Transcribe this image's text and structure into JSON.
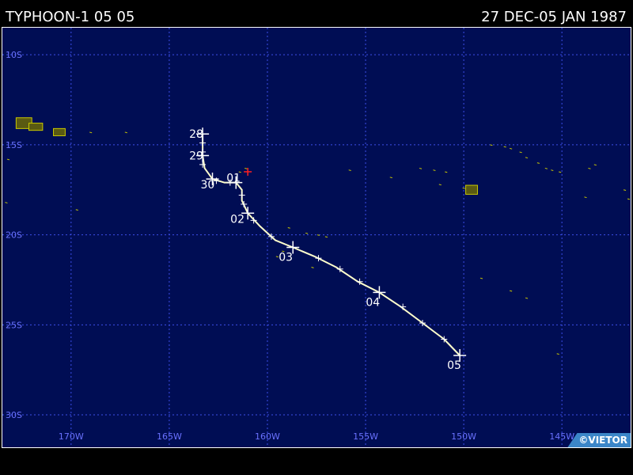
{
  "header": {
    "title": "TYPHOON-1 05 05",
    "date_range": "27 DEC-05 JAN 1987"
  },
  "credit": "©VIETOR",
  "colors": {
    "page_background": "#000000",
    "ocean": "#000d54",
    "grid": "#3c4ee8",
    "axis_label": "#6a72ff",
    "track": "#ffffcc",
    "land_fill": "#5a5a12",
    "land_outline": "#c8c800",
    "current_position": "#ff2020",
    "text": "#ffffff"
  },
  "map": {
    "projection": "equirectangular",
    "lon_range_west": [
      173.5,
      141.5
    ],
    "lat_range_south": [
      8.5,
      31.8
    ],
    "grid": true,
    "latitude_lines": [
      {
        "value": 10,
        "label": "10S"
      },
      {
        "value": 15,
        "label": "15S"
      },
      {
        "value": 20,
        "label": "20S"
      },
      {
        "value": 25,
        "label": "25S"
      },
      {
        "value": 30,
        "label": "30S"
      }
    ],
    "longitude_lines": [
      {
        "value": 170,
        "label": "170W"
      },
      {
        "value": 165,
        "label": "165W"
      },
      {
        "value": 160,
        "label": "160W"
      },
      {
        "value": 155,
        "label": "155W"
      },
      {
        "value": 150,
        "label": "150W"
      },
      {
        "value": 145,
        "label": "145W"
      }
    ]
  },
  "storm_track": {
    "points": [
      {
        "lon": 163.3,
        "lat": 14.4
      },
      {
        "lon": 163.3,
        "lat": 15.0
      },
      {
        "lon": 163.3,
        "lat": 15.6
      },
      {
        "lon": 163.2,
        "lat": 16.3
      },
      {
        "lon": 162.8,
        "lat": 16.9
      },
      {
        "lon": 162.2,
        "lat": 17.1
      },
      {
        "lon": 161.6,
        "lat": 17.1
      },
      {
        "lon": 161.3,
        "lat": 17.5
      },
      {
        "lon": 161.3,
        "lat": 18.1
      },
      {
        "lon": 161.0,
        "lat": 18.8
      },
      {
        "lon": 160.4,
        "lat": 19.5
      },
      {
        "lon": 159.6,
        "lat": 20.3
      },
      {
        "lon": 158.7,
        "lat": 20.7
      },
      {
        "lon": 157.6,
        "lat": 21.2
      },
      {
        "lon": 156.5,
        "lat": 21.8
      },
      {
        "lon": 155.4,
        "lat": 22.6
      },
      {
        "lon": 154.3,
        "lat": 23.2
      },
      {
        "lon": 153.2,
        "lat": 24.0
      },
      {
        "lon": 152.1,
        "lat": 24.9
      },
      {
        "lon": 151.0,
        "lat": 25.8
      },
      {
        "lon": 150.2,
        "lat": 26.7
      }
    ],
    "six_hour_marks": [
      {
        "lon": 163.3,
        "lat": 14.9
      },
      {
        "lon": 163.3,
        "lat": 15.4
      },
      {
        "lon": 163.3,
        "lat": 16.1
      },
      {
        "lon": 162.6,
        "lat": 17.0
      },
      {
        "lon": 161.9,
        "lat": 17.1
      },
      {
        "lon": 161.3,
        "lat": 17.8
      },
      {
        "lon": 161.2,
        "lat": 18.3
      },
      {
        "lon": 160.7,
        "lat": 19.2
      },
      {
        "lon": 159.8,
        "lat": 20.1
      },
      {
        "lon": 157.4,
        "lat": 21.3
      },
      {
        "lon": 156.3,
        "lat": 21.9
      },
      {
        "lon": 155.3,
        "lat": 22.6
      },
      {
        "lon": 153.1,
        "lat": 24.0
      },
      {
        "lon": 152.1,
        "lat": 24.9
      },
      {
        "lon": 151.0,
        "lat": 25.8
      }
    ],
    "daily_positions": [
      {
        "label": "28",
        "lon": 163.3,
        "lat": 14.4,
        "label_dx": -17,
        "label_dy": 5
      },
      {
        "label": "29",
        "lon": 163.3,
        "lat": 15.6,
        "label_dx": -17,
        "label_dy": 5
      },
      {
        "label": "30",
        "lon": 162.8,
        "lat": 16.9,
        "label_dx": -15,
        "label_dy": 12
      },
      {
        "label": "01",
        "lon": 161.6,
        "lat": 17.1,
        "label_dx": -12,
        "label_dy": -1
      },
      {
        "label": "02",
        "lon": 161.0,
        "lat": 18.8,
        "label_dx": -22,
        "label_dy": 12
      },
      {
        "label": "03",
        "lon": 158.7,
        "lat": 20.7,
        "label_dx": -18,
        "label_dy": 17
      },
      {
        "label": "04",
        "lon": 154.3,
        "lat": 23.2,
        "label_dx": -17,
        "label_dy": 17
      },
      {
        "label": "05",
        "lon": 150.2,
        "lat": 26.7,
        "label_dx": -16,
        "label_dy": 17
      }
    ],
    "current_marker": {
      "lon": 161.0,
      "lat": 16.5
    }
  },
  "islands": [
    {
      "lon": 172.4,
      "lat": 13.8,
      "w": 0.8,
      "h": 0.6
    },
    {
      "lon": 171.8,
      "lat": 14.0,
      "w": 0.7,
      "h": 0.4
    },
    {
      "lon": 170.6,
      "lat": 14.3,
      "w": 0.6,
      "h": 0.4
    },
    {
      "lon": 149.6,
      "lat": 17.5,
      "w": 0.6,
      "h": 0.5
    }
  ],
  "islets": [
    {
      "lon": 169.0,
      "lat": 14.3
    },
    {
      "lon": 167.2,
      "lat": 14.3
    },
    {
      "lon": 173.2,
      "lat": 15.8
    },
    {
      "lon": 173.3,
      "lat": 18.2
    },
    {
      "lon": 169.7,
      "lat": 18.6
    },
    {
      "lon": 161.4,
      "lat": 16.5
    },
    {
      "lon": 161.1,
      "lat": 16.3
    },
    {
      "lon": 158.9,
      "lat": 19.6
    },
    {
      "lon": 158.0,
      "lat": 19.9
    },
    {
      "lon": 157.4,
      "lat": 20.0
    },
    {
      "lon": 157.0,
      "lat": 20.1
    },
    {
      "lon": 159.2,
      "lat": 20.9
    },
    {
      "lon": 159.5,
      "lat": 21.2
    },
    {
      "lon": 157.7,
      "lat": 21.8
    },
    {
      "lon": 155.8,
      "lat": 16.4
    },
    {
      "lon": 153.7,
      "lat": 16.8
    },
    {
      "lon": 152.2,
      "lat": 16.3
    },
    {
      "lon": 151.5,
      "lat": 16.4
    },
    {
      "lon": 150.9,
      "lat": 16.5
    },
    {
      "lon": 151.2,
      "lat": 17.2
    },
    {
      "lon": 150.0,
      "lat": 17.4
    },
    {
      "lon": 148.6,
      "lat": 15.0
    },
    {
      "lon": 147.9,
      "lat": 15.1
    },
    {
      "lon": 147.6,
      "lat": 15.2
    },
    {
      "lon": 147.1,
      "lat": 15.4
    },
    {
      "lon": 146.8,
      "lat": 15.7
    },
    {
      "lon": 146.2,
      "lat": 16.0
    },
    {
      "lon": 145.8,
      "lat": 16.3
    },
    {
      "lon": 145.5,
      "lat": 16.4
    },
    {
      "lon": 145.1,
      "lat": 16.5
    },
    {
      "lon": 143.3,
      "lat": 16.1
    },
    {
      "lon": 143.6,
      "lat": 16.3
    },
    {
      "lon": 141.8,
      "lat": 17.5
    },
    {
      "lon": 141.6,
      "lat": 18.0
    },
    {
      "lon": 143.8,
      "lat": 17.9
    },
    {
      "lon": 149.1,
      "lat": 22.4
    },
    {
      "lon": 147.6,
      "lat": 23.1
    },
    {
      "lon": 146.8,
      "lat": 23.5
    },
    {
      "lon": 145.2,
      "lat": 26.6
    }
  ]
}
